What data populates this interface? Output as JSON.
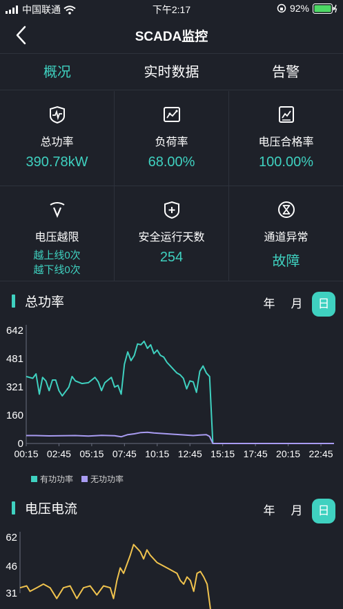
{
  "status_bar": {
    "carrier": "中国联通",
    "time": "下午2:17",
    "battery": "92%"
  },
  "nav": {
    "title": "SCADA监控"
  },
  "tabs": [
    {
      "label": "概况",
      "active": true
    },
    {
      "label": "实时数据",
      "active": false
    },
    {
      "label": "告警",
      "active": false
    }
  ],
  "metrics": [
    {
      "label": "总功率",
      "value": "390.78kW",
      "icon": "pulse-shield-icon"
    },
    {
      "label": "负荷率",
      "value": "68.00%",
      "icon": "line-chart-icon"
    },
    {
      "label": "电压合格率",
      "value": "100.00%",
      "icon": "trend-chart-icon"
    },
    {
      "label": "电压越限",
      "sub1": "越上线0次",
      "sub2": "越下线0次",
      "icon": "voltage-icon"
    },
    {
      "label": "安全运行天数",
      "value": "254",
      "icon": "shield-plus-icon"
    },
    {
      "label": "通道异常",
      "value": "故障",
      "icon": "hourglass-icon"
    }
  ],
  "power_section": {
    "title": "总功率",
    "periods": [
      "年",
      "月",
      "日"
    ],
    "active_period": "日"
  },
  "voltage_section": {
    "title": "电压电流",
    "periods": [
      "年",
      "月",
      "日"
    ],
    "active_period": "日"
  },
  "colors": {
    "accent": "#3fd1c0",
    "reactive": "#a99cf2",
    "voltage": "#f0c34e",
    "background": "#1e2129"
  },
  "chart_data": [
    {
      "type": "line",
      "title": "",
      "xlabel": "",
      "ylabel": "",
      "y_ticks": [
        0,
        160,
        321,
        481,
        642
      ],
      "ylim": [
        0,
        642
      ],
      "x_tick_labels": [
        "00:15",
        "02:45",
        "05:15",
        "07:45",
        "10:15",
        "12:45",
        "15:15",
        "17:45",
        "20:15",
        "22:45"
      ],
      "x_range_hours": [
        0.25,
        23.75
      ],
      "grid": false,
      "legend": "bottom-left",
      "series": [
        {
          "name": "有功功率",
          "color": "#3fd1c0",
          "points": [
            [
              0.25,
              380
            ],
            [
              0.75,
              370
            ],
            [
              1.0,
              395
            ],
            [
              1.25,
              280
            ],
            [
              1.5,
              375
            ],
            [
              1.75,
              355
            ],
            [
              2.0,
              300
            ],
            [
              2.25,
              360
            ],
            [
              2.5,
              360
            ],
            [
              2.75,
              300
            ],
            [
              3.0,
              270
            ],
            [
              3.5,
              320
            ],
            [
              3.75,
              380
            ],
            [
              4.0,
              355
            ],
            [
              4.5,
              340
            ],
            [
              5.0,
              345
            ],
            [
              5.5,
              375
            ],
            [
              5.75,
              350
            ],
            [
              6.0,
              300
            ],
            [
              6.25,
              345
            ],
            [
              6.5,
              360
            ],
            [
              6.75,
              375
            ],
            [
              7.0,
              320
            ],
            [
              7.25,
              330
            ],
            [
              7.5,
              280
            ],
            [
              7.75,
              450
            ],
            [
              8.0,
              520
            ],
            [
              8.25,
              470
            ],
            [
              8.5,
              500
            ],
            [
              8.75,
              565
            ],
            [
              9.0,
              560
            ],
            [
              9.25,
              580
            ],
            [
              9.5,
              540
            ],
            [
              9.75,
              560
            ],
            [
              10.0,
              510
            ],
            [
              10.25,
              530
            ],
            [
              10.5,
              500
            ],
            [
              10.75,
              490
            ],
            [
              11.0,
              460
            ],
            [
              11.25,
              440
            ],
            [
              11.5,
              420
            ],
            [
              11.75,
              400
            ],
            [
              12.0,
              390
            ],
            [
              12.25,
              370
            ],
            [
              12.5,
              310
            ],
            [
              12.75,
              355
            ],
            [
              13.0,
              350
            ],
            [
              13.25,
              290
            ],
            [
              13.5,
              410
            ],
            [
              13.75,
              440
            ],
            [
              14.0,
              400
            ],
            [
              14.25,
              380
            ],
            [
              14.5,
              0
            ],
            [
              23.75,
              0
            ]
          ]
        },
        {
          "name": "无功功率",
          "color": "#a99cf2",
          "points": [
            [
              0.25,
              45
            ],
            [
              1.0,
              45
            ],
            [
              2.0,
              43
            ],
            [
              3.0,
              44
            ],
            [
              4.0,
              45
            ],
            [
              5.0,
              42
            ],
            [
              6.0,
              46
            ],
            [
              7.0,
              44
            ],
            [
              7.5,
              38
            ],
            [
              8.0,
              50
            ],
            [
              8.5,
              55
            ],
            [
              9.0,
              62
            ],
            [
              9.5,
              64
            ],
            [
              10.0,
              60
            ],
            [
              11.0,
              55
            ],
            [
              12.0,
              50
            ],
            [
              13.0,
              45
            ],
            [
              13.5,
              48
            ],
            [
              14.0,
              50
            ],
            [
              14.25,
              40
            ],
            [
              14.5,
              0
            ],
            [
              23.75,
              0
            ]
          ]
        }
      ]
    },
    {
      "type": "line",
      "title": "",
      "xlabel": "",
      "ylabel": "",
      "y_ticks": [
        31,
        46,
        62
      ],
      "ylim": [
        31,
        62
      ],
      "x_range_hours": [
        0.25,
        23.75
      ],
      "grid": false,
      "series": [
        {
          "name": "",
          "color": "#f0c34e",
          "points": [
            [
              0.25,
              34
            ],
            [
              0.75,
              35
            ],
            [
              1.0,
              32
            ],
            [
              1.5,
              34
            ],
            [
              2.0,
              36
            ],
            [
              2.5,
              34
            ],
            [
              3.0,
              28
            ],
            [
              3.5,
              34
            ],
            [
              4.0,
              35
            ],
            [
              4.5,
              28
            ],
            [
              5.0,
              34
            ],
            [
              5.5,
              35
            ],
            [
              6.0,
              30
            ],
            [
              6.5,
              35
            ],
            [
              7.0,
              34
            ],
            [
              7.25,
              28
            ],
            [
              7.5,
              38
            ],
            [
              7.75,
              45
            ],
            [
              8.0,
              42
            ],
            [
              8.5,
              52
            ],
            [
              8.75,
              58
            ],
            [
              9.0,
              56
            ],
            [
              9.25,
              54
            ],
            [
              9.5,
              50
            ],
            [
              9.75,
              55
            ],
            [
              10.0,
              52
            ],
            [
              10.5,
              48
            ],
            [
              11.0,
              46
            ],
            [
              11.5,
              44
            ],
            [
              12.0,
              42
            ],
            [
              12.25,
              38
            ],
            [
              12.5,
              36
            ],
            [
              12.75,
              40
            ],
            [
              13.0,
              38
            ],
            [
              13.25,
              32
            ],
            [
              13.5,
              42
            ],
            [
              13.75,
              43
            ],
            [
              14.0,
              40
            ],
            [
              14.25,
              36
            ],
            [
              14.5,
              20
            ]
          ]
        }
      ]
    }
  ]
}
